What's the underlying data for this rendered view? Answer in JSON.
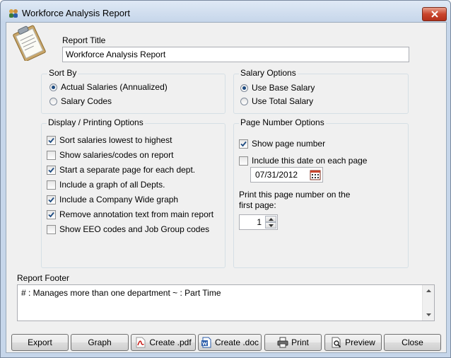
{
  "window": {
    "title": "Workforce Analysis Report"
  },
  "report_title": {
    "label": "Report Title",
    "value": "Workforce Analysis Report"
  },
  "sort_by": {
    "title": "Sort By",
    "options": [
      {
        "label": "Actual Salaries (Annualized)",
        "selected": true
      },
      {
        "label": "Salary Codes",
        "selected": false
      }
    ]
  },
  "salary_options": {
    "title": "Salary Options",
    "options": [
      {
        "label": "Use Base Salary",
        "selected": true
      },
      {
        "label": "Use Total Salary",
        "selected": false
      }
    ]
  },
  "display_options": {
    "title": "Display / Printing Options",
    "items": [
      {
        "label": "Sort salaries lowest to highest",
        "checked": true
      },
      {
        "label": "Show salaries/codes on report",
        "checked": false
      },
      {
        "label": "Start a separate page for each dept.",
        "checked": true
      },
      {
        "label": "Include a graph of all Depts.",
        "checked": false
      },
      {
        "label": "Include a Company Wide graph",
        "checked": true
      },
      {
        "label": "Remove annotation text from main report",
        "checked": true
      },
      {
        "label": "Show EEO codes and Job Group codes",
        "checked": false
      }
    ]
  },
  "page_number_options": {
    "title": "Page Number Options",
    "show_page_number": {
      "label": "Show page number",
      "checked": true
    },
    "include_date": {
      "label": "Include this date on each page",
      "checked": false
    },
    "date_value": "07/31/2012",
    "first_page_label_line1": "Print this page number on the",
    "first_page_label_line2": "first page:",
    "first_page_value": "1"
  },
  "report_footer": {
    "label": "Report Footer",
    "value": "# : Manages more than one department  ~ : Part Time"
  },
  "buttons": {
    "export": "Export",
    "graph": "Graph",
    "create_pdf": "Create .pdf",
    "create_doc": "Create .doc",
    "print": "Print",
    "preview": "Preview",
    "close": "Close"
  },
  "colors": {
    "accent": "#1c4a80",
    "close_button": "#c9452d",
    "pdf_red": "#c8201a",
    "doc_blue": "#2a5caa"
  }
}
